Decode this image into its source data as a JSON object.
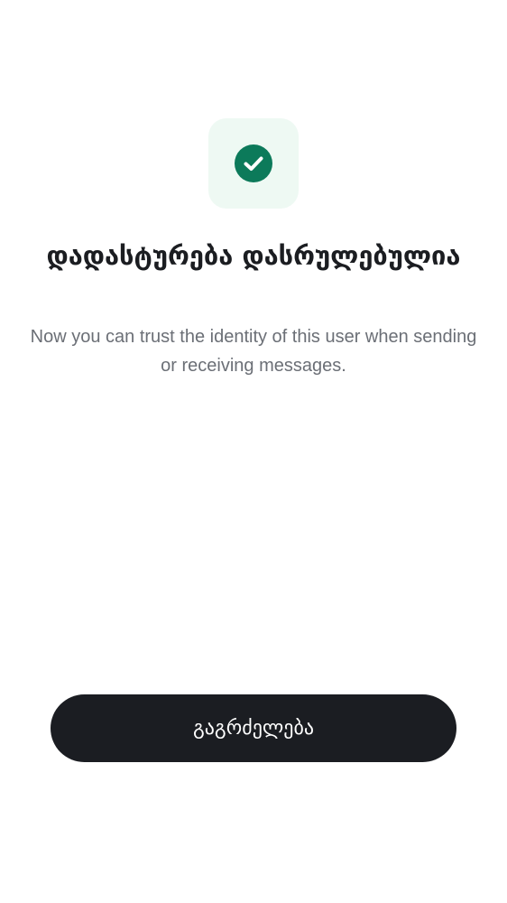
{
  "verification": {
    "title": "დადასტურება დასრულებულია",
    "description": "Now you can trust the identity of this user when sending or receiving messages.",
    "icon": "check-circle-icon"
  },
  "actions": {
    "continue_label": "გაგრძელება"
  },
  "colors": {
    "accent": "#0c7a5a",
    "icon_tile_bg": "#eef9f3",
    "button_bg": "#1b1d22",
    "title_text": "#1b1d21",
    "body_text": "#6b6f76"
  }
}
